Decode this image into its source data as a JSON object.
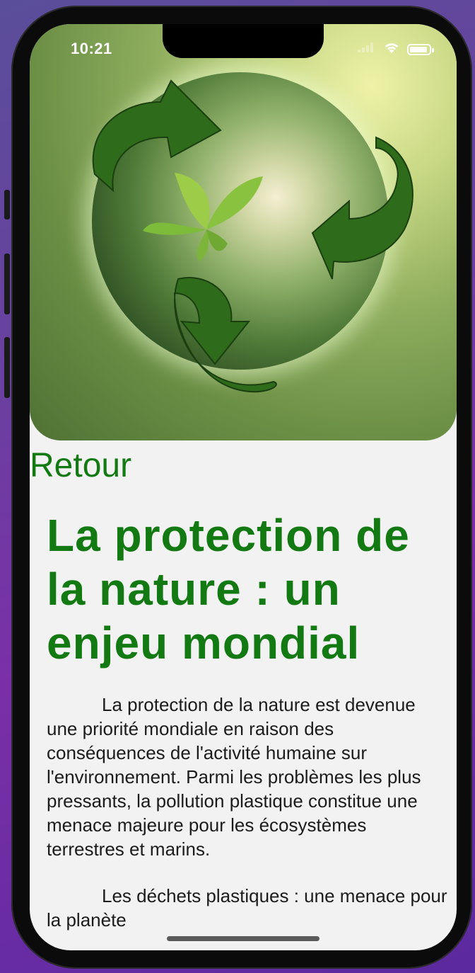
{
  "status_bar": {
    "time": "10:21"
  },
  "navigation": {
    "back_label": "Retour"
  },
  "article": {
    "title": "La protection de la nature : un enjeu mondial",
    "paragraphs": [
      "La protection de la nature est devenue une priorité mondiale en raison des conséquences de l'activité humaine sur l'environnement. Parmi les problèmes les plus pressants, la pollution plastique constitue une menace majeure pour les écosystèmes terrestres et marins.",
      "Les déchets plastiques : une menace pour la planète"
    ]
  },
  "hero": {
    "icon": "recycling-globe-image"
  },
  "colors": {
    "accent": "#137a13",
    "text": "#1c1c1c",
    "background": "#f2f2f2"
  }
}
